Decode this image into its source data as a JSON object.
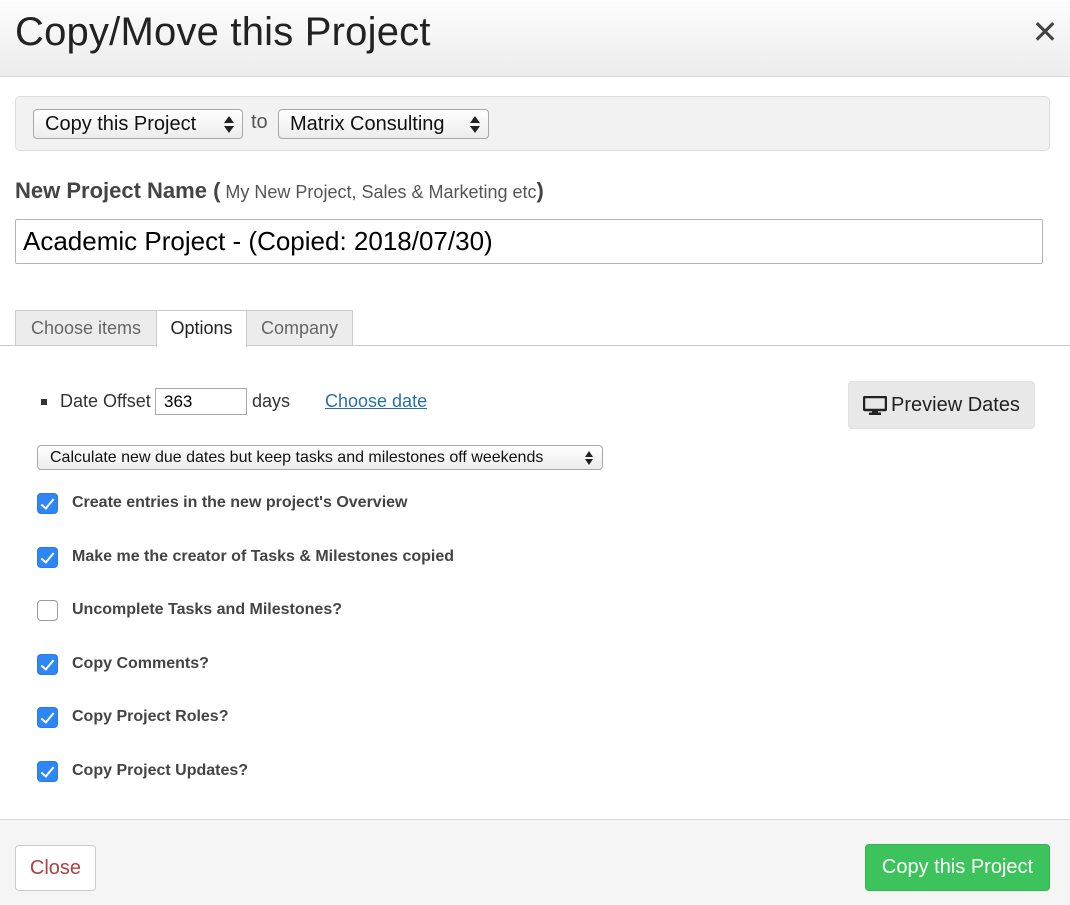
{
  "dialog": {
    "title": "Copy/Move this Project",
    "close_icon": "close-icon"
  },
  "copy_bar": {
    "mode_selected": "Copy this Project",
    "to_label": "to",
    "company_selected": "Matrix Consulting"
  },
  "project_name": {
    "label": "New Project Name",
    "open_paren": " (",
    "hint": " My New Project, Sales & Marketing etc",
    "close_paren": ")",
    "value": "Academic Project - (Copied: 2018/07/30)"
  },
  "tabs": [
    {
      "label": "Choose items",
      "active": false
    },
    {
      "label": "Options",
      "active": true
    },
    {
      "label": "Company",
      "active": false
    }
  ],
  "options": {
    "date_offset_label": "Date Offset",
    "date_offset_value": "363",
    "days_label": "days",
    "choose_date_link": "Choose date",
    "preview_button": {
      "icon": "monitor-icon",
      "label": "Preview Dates"
    },
    "due_date_mode_selected": "Calculate new due dates but keep tasks and milestones off weekends",
    "checkboxes": [
      {
        "label": "Create entries in the new project's Overview",
        "checked": true
      },
      {
        "label": "Make me the creator of Tasks & Milestones copied",
        "checked": true
      },
      {
        "label": "Uncomplete Tasks and Milestones?",
        "checked": false
      },
      {
        "label": "Copy Comments?",
        "checked": true
      },
      {
        "label": "Copy Project Roles?",
        "checked": true
      },
      {
        "label": "Copy Project Updates?",
        "checked": true
      }
    ]
  },
  "footer": {
    "close_label": "Close",
    "submit_label": "Copy this Project"
  },
  "colors": {
    "accent_green": "#3cc35b",
    "checkbox_blue": "#2f86f6",
    "link_blue": "#2a6fa8",
    "close_red": "#b04040"
  }
}
